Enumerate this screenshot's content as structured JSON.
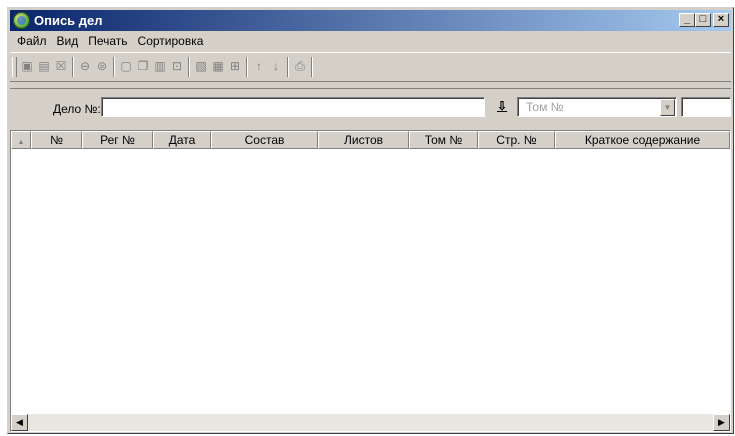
{
  "window": {
    "title": "Опись дел",
    "buttons": {
      "minimize": "_",
      "maximize": "□",
      "close": "×"
    }
  },
  "menu": [
    "Файл",
    "Вид",
    "Печать",
    "Сортировка"
  ],
  "toolbar": {
    "icons": [
      "edit-icon",
      "save-icon",
      "edit-record-icon",
      "lock-icon",
      "unlock-icon",
      "document-icon",
      "copy-icon",
      "paste-icon",
      "preview-icon",
      "transfer-icon",
      "print-list-icon",
      "insert-icon",
      "arrow-up-icon",
      "arrow-down-icon",
      "print-icon"
    ]
  },
  "filter": {
    "case_label": "Дело №:",
    "case_value": "",
    "sort_symbol": "⇩",
    "volume_placeholder": "Том №",
    "dropdown_arrow": "▼",
    "extra_value": ""
  },
  "table": {
    "sort_indicator": "▲",
    "columns": [
      "№",
      "Рег №",
      "Дата",
      "Состав",
      "Листов",
      "Том №",
      "Стр. №",
      "Краткое содержание"
    ],
    "rows": []
  },
  "scrollbar": {
    "left_arrow": "◀",
    "right_arrow": "▶"
  }
}
